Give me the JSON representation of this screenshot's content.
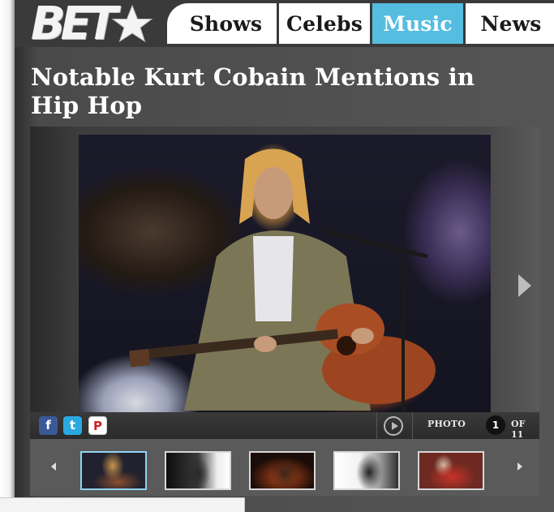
{
  "header": {
    "logo_text": "BET",
    "logo_icon": "star-icon",
    "nav": [
      {
        "label": "Shows",
        "active": false
      },
      {
        "label": "Celebs",
        "active": false
      },
      {
        "label": "Music",
        "active": true
      },
      {
        "label": "News",
        "active": false
      }
    ],
    "accent_color": "#55bde0"
  },
  "article": {
    "title": "Notable Kurt Cobain Mentions in Hip Hop"
  },
  "gallery": {
    "photo_icon": "kurt-cobain-playing-guitar-photo",
    "next_icon": "chevron-right-icon",
    "share": [
      {
        "icon": "facebook-icon",
        "glyph": "f"
      },
      {
        "icon": "twitter-icon",
        "glyph": "t"
      },
      {
        "icon": "pinterest-icon",
        "glyph": "P"
      }
    ],
    "play_icon": "play-icon",
    "photo_label": "PHOTO",
    "current": "1",
    "of_label": "OF 11",
    "thumbnails_count": 5
  }
}
